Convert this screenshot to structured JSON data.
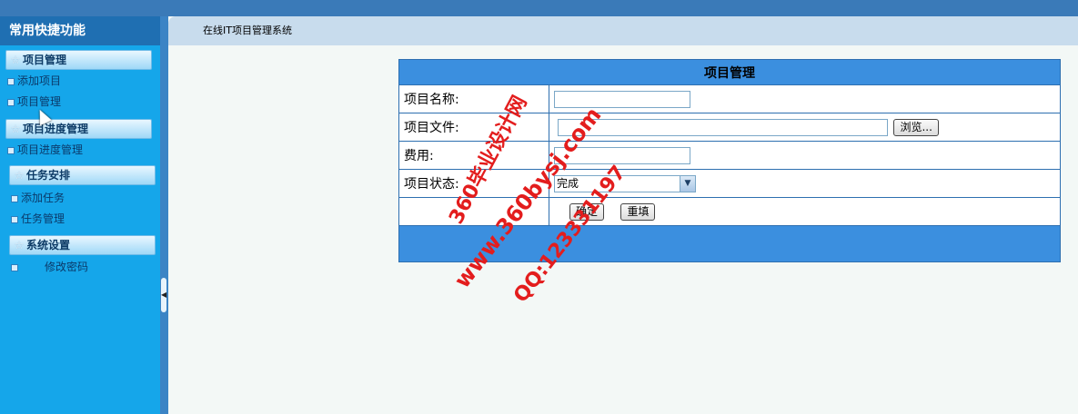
{
  "sidebar": {
    "title": "常用快捷功能",
    "groups": [
      {
        "label": "项目管理",
        "items": [
          "添加项目",
          "项目管理"
        ]
      },
      {
        "label": "项目进度管理",
        "items": [
          "项目进度管理"
        ]
      },
      {
        "label": "任务安排",
        "items": [
          "添加任务",
          "任务管理"
        ]
      },
      {
        "label": "系统设置",
        "items": [
          "修改密码"
        ]
      }
    ]
  },
  "header": {
    "title": "在线IT项目管理系统"
  },
  "form": {
    "title": "项目管理",
    "fields": {
      "name_label": "项目名称:",
      "file_label": "项目文件:",
      "browse_label": "浏览...",
      "cost_label": "费用:",
      "status_label": "项目状态:",
      "status_value": "完成"
    },
    "buttons": {
      "confirm": "确定",
      "reset": "重填"
    }
  },
  "watermark": {
    "line1": "360毕业设计网",
    "line2": "www.360bysj.com",
    "line3": "QQ:123331197"
  },
  "colors": {
    "sidebar": "#15a6ea",
    "table_header": "#3b8fdf",
    "watermark": "#e31d1d"
  }
}
